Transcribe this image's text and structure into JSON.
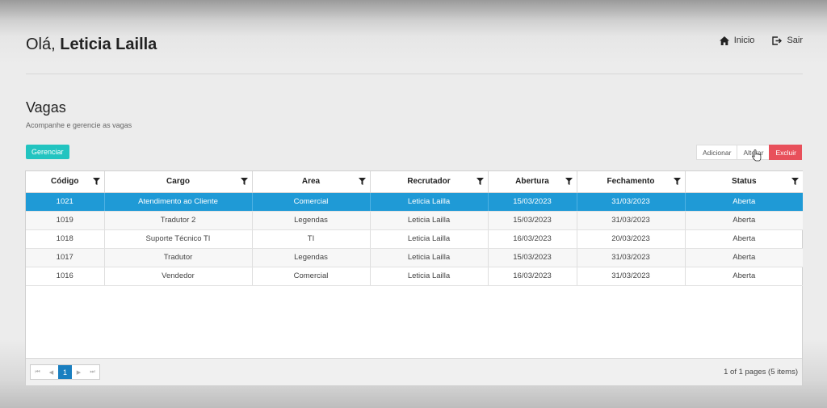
{
  "header": {
    "greeting_prefix": "Olá,",
    "user_name": "Leticia Lailla",
    "nav": [
      {
        "label": "Inicio",
        "icon": "home-icon"
      },
      {
        "label": "Sair",
        "icon": "logout-icon"
      }
    ]
  },
  "page": {
    "title": "Vagas",
    "subtitle": "Acompanhe e gerencie as vagas"
  },
  "actions": {
    "manage_label": "Gerenciar",
    "add_label": "Adicionar",
    "edit_label": "Alterar",
    "delete_label": "Excluir"
  },
  "grid": {
    "columns": [
      "Código",
      "Cargo",
      "Area",
      "Recrutador",
      "Abertura",
      "Fechamento",
      "Status"
    ],
    "rows": [
      [
        "1021",
        "Atendimento ao Cliente",
        "Comercial",
        "Leticia Lailla",
        "15/03/2023",
        "31/03/2023",
        "Aberta"
      ],
      [
        "1019",
        "Tradutor 2",
        "Legendas",
        "Leticia Lailla",
        "15/03/2023",
        "31/03/2023",
        "Aberta"
      ],
      [
        "1018",
        "Suporte Técnico TI",
        "TI",
        "Leticia Lailla",
        "16/03/2023",
        "20/03/2023",
        "Aberta"
      ],
      [
        "1017",
        "Tradutor",
        "Legendas",
        "Leticia Lailla",
        "15/03/2023",
        "31/03/2023",
        "Aberta"
      ],
      [
        "1016",
        "Vendedor",
        "Comercial",
        "Leticia Lailla",
        "16/03/2023",
        "31/03/2023",
        "Aberta"
      ]
    ],
    "selected_row": 0
  },
  "pager": {
    "current_page": "1",
    "info": "1 of 1 pages (5 items)"
  },
  "colors": {
    "accent": "#22c4c0",
    "selected": "#1f9ad6",
    "danger": "#e8505b"
  }
}
